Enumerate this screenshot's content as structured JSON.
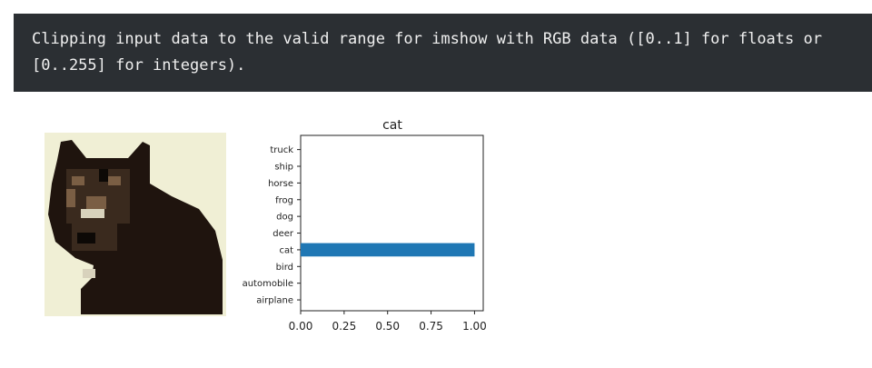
{
  "output": {
    "warning_text": "Clipping input data to the valid range for imshow with RGB data ([0..1] for floats or [0..255] for integers)."
  },
  "image": {
    "subject": "cat"
  },
  "chart_data": {
    "type": "bar",
    "orientation": "horizontal",
    "title": "cat",
    "categories": [
      "airplane",
      "automobile",
      "bird",
      "cat",
      "deer",
      "dog",
      "frog",
      "horse",
      "ship",
      "truck"
    ],
    "values": [
      0,
      0,
      0,
      1.0,
      0,
      0,
      0,
      0,
      0,
      0
    ],
    "xlabel": "",
    "ylabel": "",
    "xlim": [
      0,
      1.05
    ],
    "xticks": [
      "0.00",
      "0.25",
      "0.50",
      "0.75",
      "1.00"
    ],
    "xtick_values": [
      0,
      0.25,
      0.5,
      0.75,
      1.0
    ],
    "grid": false,
    "bar_color": "#1f77b4"
  }
}
